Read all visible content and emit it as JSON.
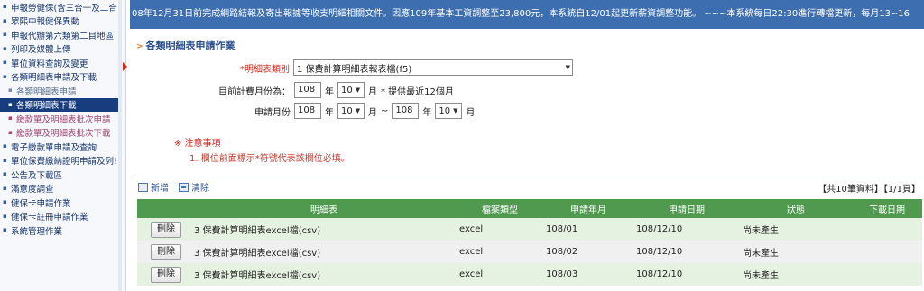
{
  "ticker": "08年12月31日前完成網路結報及寄出報據等收支明細相關文件。因應109年基本工資調整至23,800元，本系統自12/01起更新薪資調整功能。 ~~~本系統每日22:30進行轉檔更新，每月13~16",
  "sidebar": {
    "items": [
      {
        "label": "申報勞健保(含三合一及二合",
        "type": "main"
      },
      {
        "label": "眾熙中報健保異動",
        "type": "main"
      },
      {
        "label": "申報代辦第六類第二目地區",
        "type": "main"
      },
      {
        "label": "列印及媒體上傳",
        "type": "main"
      },
      {
        "label": "單位資料查詢及變更",
        "type": "main"
      },
      {
        "label": "各類明細表申請及下載",
        "type": "main"
      },
      {
        "label": "各類明細表申請",
        "type": "sub"
      },
      {
        "label": "各類明細表下載",
        "type": "active"
      },
      {
        "label": "繳款單及明細表批次申請",
        "type": "pink"
      },
      {
        "label": "繳款單及明細表批次下載",
        "type": "pink"
      },
      {
        "label": "電子繳款單申請及查詢",
        "type": "main"
      },
      {
        "label": "單位保費繳納證明申請及列!",
        "type": "main"
      },
      {
        "label": "公告及下載區",
        "type": "main"
      },
      {
        "label": "滿意度調查",
        "type": "main"
      },
      {
        "label": "健保卡申請作業",
        "type": "main"
      },
      {
        "label": "健保卡註冊申請作業",
        "type": "main"
      },
      {
        "label": "系統管理作業",
        "type": "main"
      }
    ]
  },
  "section_title": "各類明細表申請作業",
  "form": {
    "report_type_label": "明細表類別",
    "report_type_required": "*",
    "report_type_value": "1 保費計算明細表報表檔(f5)",
    "current_month_label": "目前計費月份為：",
    "current_year": "108",
    "year_unit": "年",
    "current_month": "10",
    "month_unit": "月",
    "current_note": "* 提供最近12個月",
    "apply_label": "申請月份",
    "from_year": "108",
    "from_month": "10",
    "tilde": "~",
    "to_year": "108",
    "to_month": "10"
  },
  "notes": {
    "title": "※ 注意事項",
    "item": "1. 欄位前面標示*符號代表該欄位必填。"
  },
  "toolbar": {
    "add_label": "新增",
    "clear_label": "清除",
    "pager": "【共10筆資料】【1/1頁】"
  },
  "table": {
    "headers": [
      "",
      "明細表",
      "檔案類型",
      "申請年月",
      "申請日期",
      "狀態",
      "下載日期"
    ],
    "rows": [
      {
        "btn": "刪除",
        "report": "3 保費計算明細表excel檔(csv)",
        "type": "excel",
        "ym": "108/01",
        "date": "108/12/10",
        "status": "尚未產生",
        "dl": ""
      },
      {
        "btn": "刪除",
        "report": "3 保費計算明細表excel檔(csv)",
        "type": "excel",
        "ym": "108/02",
        "date": "108/12/10",
        "status": "尚未產生",
        "dl": ""
      },
      {
        "btn": "刪除",
        "report": "3 保費計算明細表excel檔(csv)",
        "type": "excel",
        "ym": "108/03",
        "date": "108/12/10",
        "status": "尚未產生",
        "dl": ""
      }
    ]
  },
  "colors": {
    "header_blue": "#3d6fb0",
    "table_header_green": "#4f9a4f",
    "active_nav": "#173d7e",
    "required_red": "#d8261c"
  }
}
